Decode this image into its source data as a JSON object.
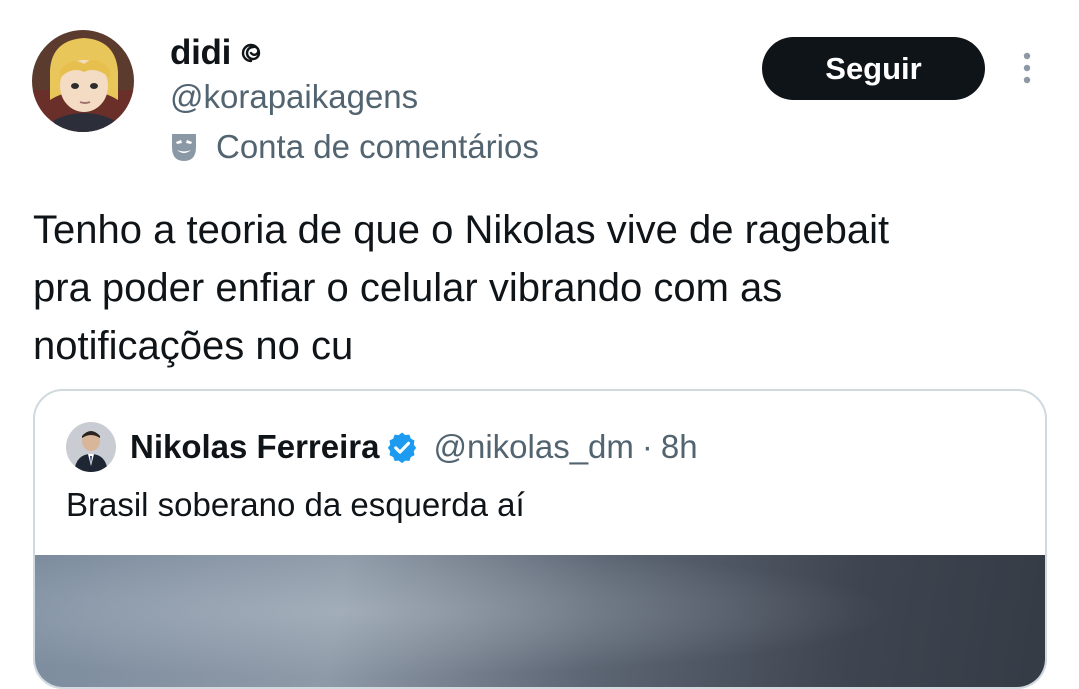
{
  "author": {
    "display_name": "didi",
    "name_emoji_icon": "swirl-icon",
    "handle": "@korapaikagens",
    "account_label": "Conta de comentários",
    "account_label_icon": "theater-mask-icon"
  },
  "actions": {
    "follow_label": "Seguir",
    "more_icon": "more-vertical-icon"
  },
  "tweet": {
    "text": "Tenho a teoria de que o Nikolas vive de ragebait\npra poder enfiar o celular vibrando com as\nnotificações no cu"
  },
  "quoted_tweet": {
    "display_name": "Nikolas Ferreira",
    "verified_icon": "verified-badge-icon",
    "handle": "@nikolas_dm",
    "separator": "·",
    "time": "8h",
    "text": "Brasil soberano da esquerda aí"
  },
  "colors": {
    "text_primary": "#0f1419",
    "text_secondary": "#536471",
    "follow_bg": "#0f1419",
    "verified_blue": "#1d9bf0",
    "card_border": "#cfd9de"
  }
}
